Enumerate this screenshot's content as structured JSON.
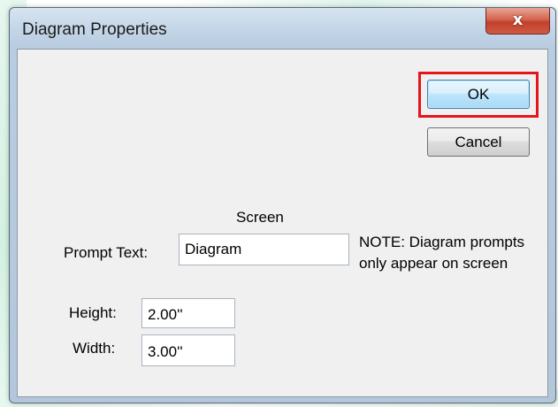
{
  "window": {
    "title": "Diagram Properties",
    "close_glyph": "x",
    "close_icon": "close-icon"
  },
  "buttons": {
    "ok_label": "OK",
    "cancel_label": "Cancel",
    "highlight_color": "#e4161b"
  },
  "form": {
    "section_label": "Screen",
    "prompt_text_label": "Prompt Text:",
    "prompt_text_value": "Diagram",
    "note_line1": "NOTE: Diagram prompts",
    "note_line2": "only appear on screen",
    "height_label": "Height:",
    "height_value": "2.00''",
    "width_label": "Width:",
    "width_value": "3.00''"
  }
}
